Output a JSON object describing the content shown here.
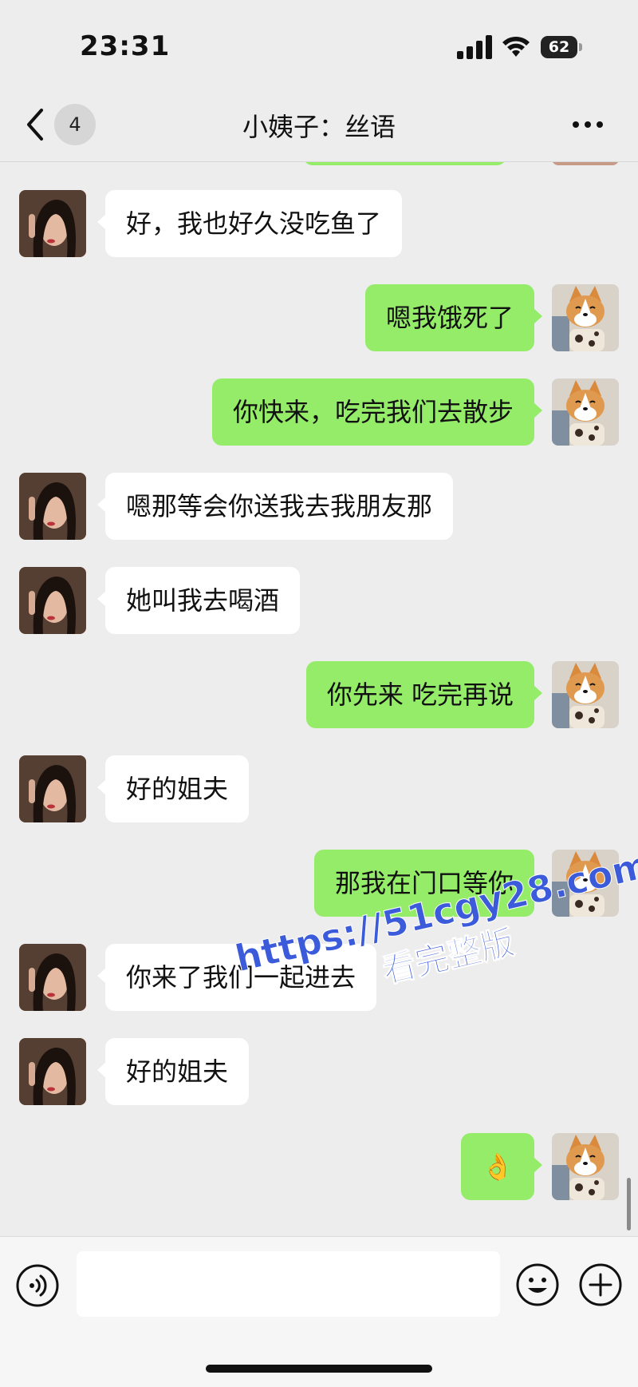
{
  "status_bar": {
    "time": "23:31",
    "battery": "62",
    "signal_icon": "cellular-signal-icon",
    "wifi_icon": "wifi-icon"
  },
  "nav": {
    "back_icon": "chevron-left-icon",
    "unread_count": "4",
    "title": "小姨子：丝语",
    "more_icon": "more-dots-icon"
  },
  "messages": [
    {
      "side": "in",
      "text": "好，我也好久没吃鱼了"
    },
    {
      "side": "out",
      "text": "嗯我饿死了"
    },
    {
      "side": "out",
      "text": "你快来，吃完我们去散步"
    },
    {
      "side": "in",
      "text": "嗯那等会你送我去我朋友那"
    },
    {
      "side": "in",
      "text": "她叫我去喝酒"
    },
    {
      "side": "out",
      "text": "你先来 吃完再说"
    },
    {
      "side": "in",
      "text": "好的姐夫"
    },
    {
      "side": "out",
      "text": "那我在门口等你"
    },
    {
      "side": "in",
      "text": "你来了我们一起进去"
    },
    {
      "side": "in",
      "text": "好的姐夫"
    },
    {
      "side": "out",
      "text": "👌"
    }
  ],
  "watermark": {
    "url": "https://51cgy28.com",
    "subtitle": "看完整版"
  },
  "input_bar": {
    "voice_icon": "voice-input-icon",
    "text_value": "",
    "emoji_icon": "emoji-icon",
    "plus_icon": "plus-icon"
  },
  "colors": {
    "background": "#ededed",
    "outgoing_bubble": "#95ec69",
    "incoming_bubble": "#ffffff",
    "watermark": "#3b5bdb"
  }
}
